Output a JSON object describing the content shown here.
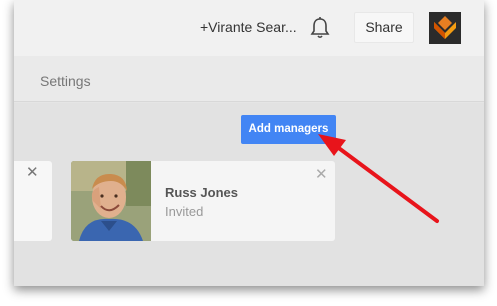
{
  "header": {
    "account_name": "+Virante Sear...",
    "share_label": "Share"
  },
  "subnav": {
    "settings_label": "Settings"
  },
  "managers": {
    "add_button_label": "Add managers",
    "cards": [
      {
        "name": "Russ Jones",
        "status": "Invited"
      }
    ]
  },
  "colors": {
    "accent_button": "#4285f4",
    "annotation_arrow": "#e8141b"
  },
  "icons": {
    "notifications": "bell-icon",
    "close": "close-icon"
  }
}
